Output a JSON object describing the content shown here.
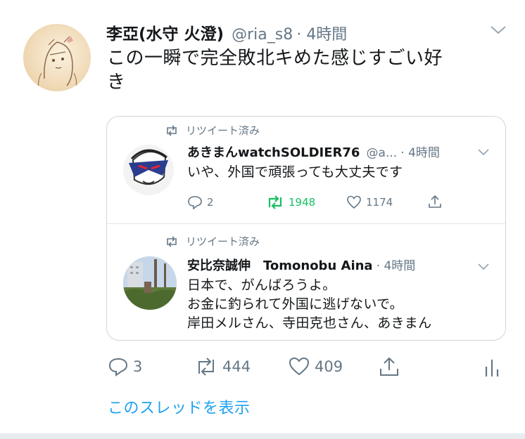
{
  "tweet": {
    "author_name": "李亞(水守 火澄)",
    "handle": "@ria_s8",
    "time": "· 4時間",
    "text_line1": "この一瞬で完全敗北キめた感じすごい好",
    "text_line2": "き"
  },
  "quote": {
    "first": {
      "retweet_label": "リツイート済み",
      "name": "あきまんwatchSOLDIER76",
      "handle": "@a...",
      "time": "· 4時間",
      "text": "いや、外国で頑張っても大丈夫です",
      "replies": "2",
      "retweets": "1948",
      "likes": "1174"
    },
    "second": {
      "retweet_label": "リツイート済み",
      "name": "安比奈誠伸　Tomonobu Aina",
      "time": "· 4時間",
      "line1": "日本で、がんばろうよ。",
      "line2": "お金に釣られて外国に逃げないで。",
      "line3": "岸田メルさん、寺田克也さん、あきまん"
    }
  },
  "actions": {
    "replies": "3",
    "retweets": "444",
    "likes": "409"
  },
  "thread_link": "このスレッドを表示",
  "colors": {
    "link": "#1da1f2",
    "retweet_green": "#17bf63",
    "muted": "#657786",
    "border": "#ccd6dd"
  }
}
